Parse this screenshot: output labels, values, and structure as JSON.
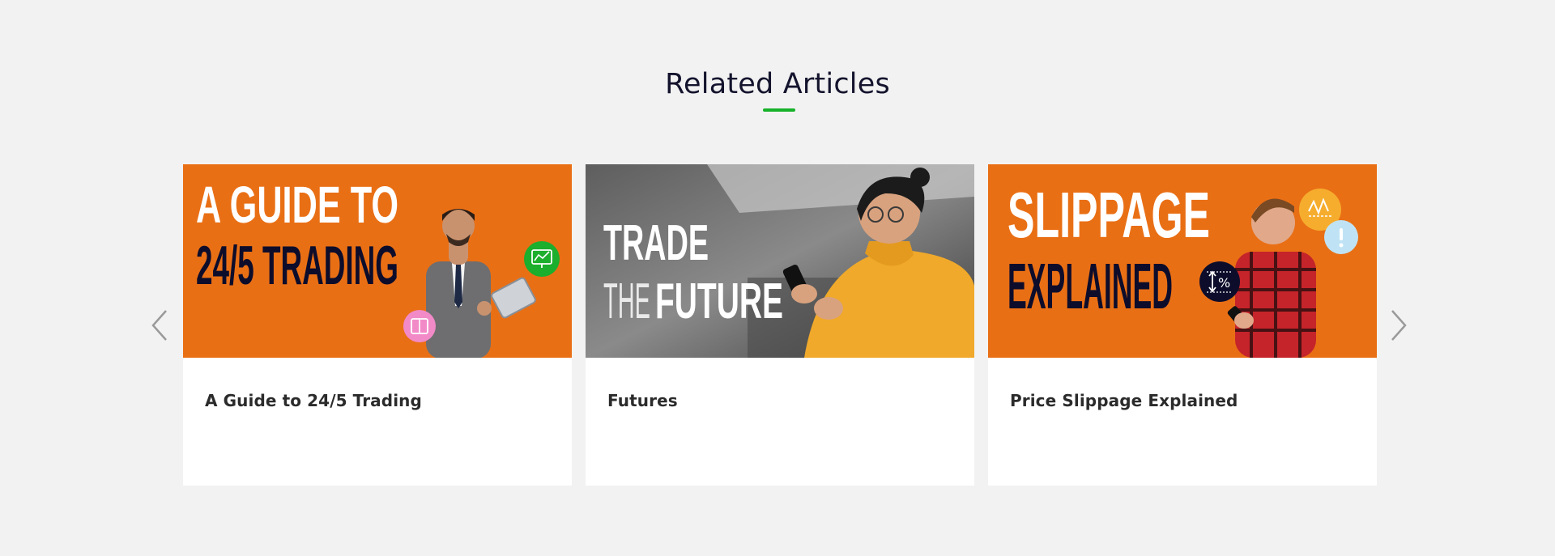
{
  "section": {
    "title": "Related Articles"
  },
  "colors": {
    "accent": "#17b22a",
    "banner_orange": "#e96f15",
    "banner_navy": "#0d0d2b",
    "page_background": "#f2f2f2",
    "card_background": "#ffffff"
  },
  "carousel": {
    "prev_icon": "chevron-left-icon",
    "next_icon": "chevron-right-icon"
  },
  "cards": [
    {
      "title": "A Guide to 24/5 Trading",
      "banner_line_1": "A GUIDE TO",
      "banner_line_2": "24/5 TRADING"
    },
    {
      "title": "Futures",
      "banner_line_1": "TRADE",
      "banner_line_2_light": "THE",
      "banner_line_2_bold": "FUTURE"
    },
    {
      "title": "Price Slippage Explained",
      "banner_line_1": "SLIPPAGE",
      "banner_line_2": "EXPLAINED"
    }
  ]
}
